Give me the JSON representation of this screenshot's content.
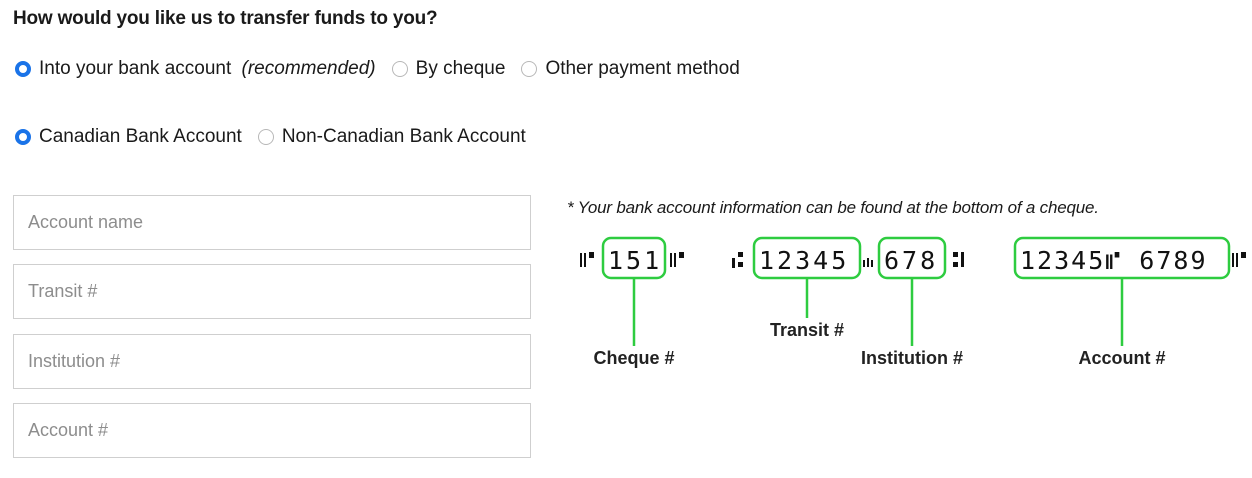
{
  "question": "How would you like us to transfer funds to you?",
  "payment_methods": {
    "bank": {
      "label": "Into your bank account",
      "note": "(recommended)",
      "selected": true
    },
    "cheque": {
      "label": "By cheque",
      "selected": false
    },
    "other": {
      "label": "Other payment method",
      "selected": false
    }
  },
  "account_types": {
    "canadian": {
      "label": "Canadian Bank Account",
      "selected": true
    },
    "non_canadian": {
      "label": "Non-Canadian Bank Account",
      "selected": false
    }
  },
  "fields": {
    "account_name": {
      "placeholder": "Account name",
      "value": ""
    },
    "transit": {
      "placeholder": "Transit #",
      "value": ""
    },
    "institution": {
      "placeholder": "Institution #",
      "value": ""
    },
    "account": {
      "placeholder": "Account #",
      "value": ""
    }
  },
  "cheque_info": {
    "hint": "* Your bank account information can be found at the bottom of a cheque.",
    "cheque_digits": "151",
    "transit_digits": "12345",
    "institution_digits": "678",
    "account_digits": "12345⑈ 6789",
    "labels": {
      "cheque": "Cheque #",
      "transit": "Transit #",
      "institution": "Institution #",
      "account": "Account #"
    },
    "highlight_color": "#2ecc40"
  }
}
